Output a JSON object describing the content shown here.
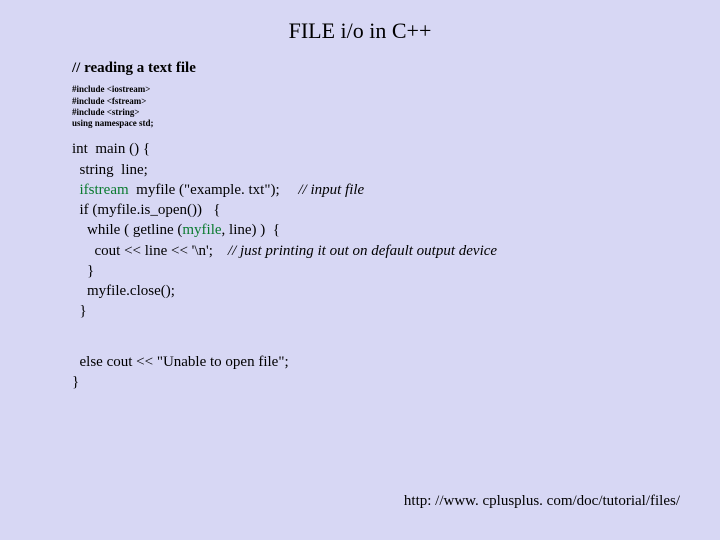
{
  "title": "FILE i/o in C++",
  "subhead": "// reading a text file",
  "preamble": [
    "#include <iostream>",
    "#include <fstream>",
    "#include <string>",
    "using namespace std;"
  ],
  "code": {
    "l1a": "int  main () {",
    "l2a": "  string  line;",
    "l3kw": "  ifstream",
    "l3b": "  myfile (\"example. txt\");     ",
    "l3c": "// input file",
    "l4a": "  if (myfile.is_open())   {",
    "l5a": "    while ( getline (",
    "l5kw": "myfile",
    "l5b": ", line) )  {",
    "l6a": "      cout << line << '\\n';    ",
    "l6c": "// just printing it out on default output device",
    "l7a": "    }",
    "l8a": "    myfile.close();",
    "l9a": "  }",
    "l11a": "  else cout << \"Unable to open file\";",
    "l12a": "}"
  },
  "footer": "http: //www. cplusplus. com/doc/tutorial/files/"
}
